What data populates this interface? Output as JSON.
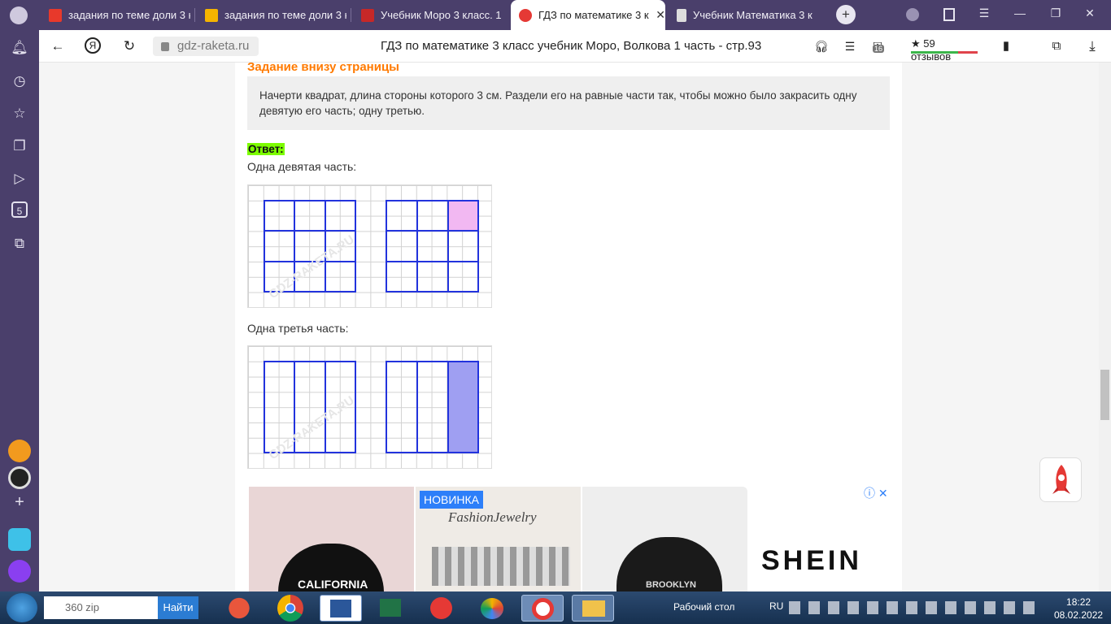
{
  "tabs": [
    {
      "title": "задания по теме доли 3 к",
      "favicon_color": "#e8392b",
      "active": false
    },
    {
      "title": "задания по теме доли 3 к",
      "favicon_color": "#f5b400",
      "active": false
    },
    {
      "title": "Учебник Моро 3 класс. 1",
      "favicon_color": "#c62828",
      "active": false
    },
    {
      "title": "ГДЗ по математике 3 к",
      "favicon_color": "#e53935",
      "active": true
    },
    {
      "title": "Учебник Математика 3 к",
      "favicon_color": "#dddddd",
      "active": false
    }
  ],
  "tab_close": "✕",
  "new_tab": "+",
  "window_buttons": [
    "☰",
    "—",
    "❐",
    "✕"
  ],
  "sidebar_icons": [
    "bell-icon",
    "history-icon",
    "star-icon",
    "collections-icon",
    "video-icon",
    "5-icon",
    "screenshot-icon"
  ],
  "sidebar_five": "5",
  "address": {
    "url": "gdz-raketa.ru",
    "page_title": "ГДЗ по математике 3 класс учебник Моро, Волкова 1 часть - стр.93",
    "reviews": "★ 59 отзывов",
    "badge": "16"
  },
  "content": {
    "task_title": "Задание внизу страницы",
    "task_text": "Начерти квадрат, длина стороны которого 3 см. Раздели его на равные части так, чтобы можно было закрасить одну девятую его часть; одну третью.",
    "answer_label": "Ответ:",
    "caption1": "Одна девятая часть:",
    "caption2": "Одна третья часть:",
    "watermark": "GDZ-RAKETA.RU"
  },
  "ad": {
    "badge": "НОВИНКА",
    "brand": "SHEIN",
    "jewelry": "FashionJewelry",
    "cap1": "CALIFORNIA",
    "cap2": "BROOKLYN",
    "close": "ⓘ ✕"
  },
  "taskbar": {
    "search_value": "360 zip",
    "search_button": "Найти",
    "desktop": "Рабочий стол",
    "lang": "RU",
    "time": "18:22",
    "date": "08.02.2022"
  }
}
